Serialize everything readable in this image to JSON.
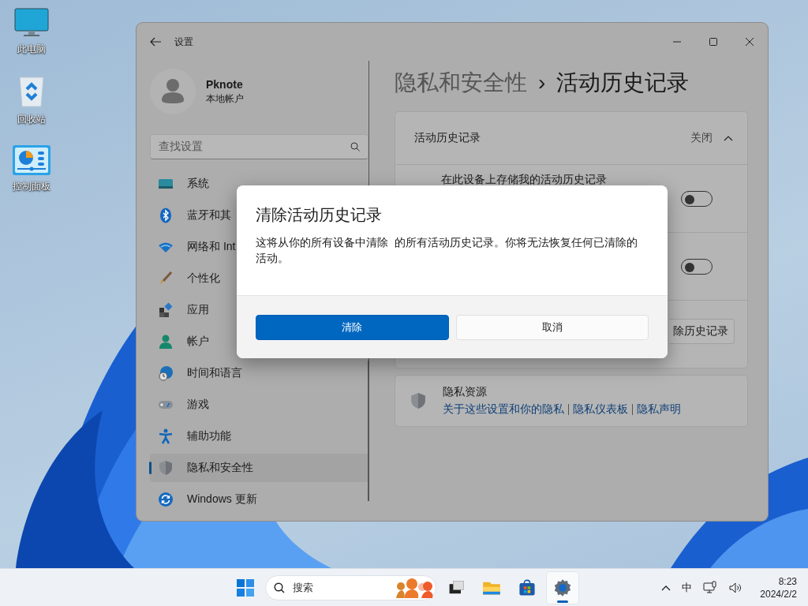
{
  "desktop_icons": [
    {
      "label": "此电脑",
      "kind": "computer"
    },
    {
      "label": "回收站",
      "kind": "recycle"
    },
    {
      "label": "控制面板",
      "kind": "control"
    }
  ],
  "settings_window": {
    "title": "设置",
    "account": {
      "name": "Pknote",
      "type": "本地帐户"
    },
    "search": {
      "placeholder": "查找设置"
    },
    "nav_items": [
      {
        "label": "系统",
        "kind": "system",
        "selected": false
      },
      {
        "label": "蓝牙和其",
        "kind": "bluetooth",
        "selected": false
      },
      {
        "label": "网络和 Int",
        "kind": "wifi",
        "selected": false
      },
      {
        "label": "个性化",
        "kind": "brush",
        "selected": false
      },
      {
        "label": "应用",
        "kind": "apps",
        "selected": false
      },
      {
        "label": "帐户",
        "kind": "person",
        "selected": false
      },
      {
        "label": "时间和语言",
        "kind": "globe",
        "selected": false
      },
      {
        "label": "游戏",
        "kind": "gamepad",
        "selected": false
      },
      {
        "label": "辅助功能",
        "kind": "accessibility",
        "selected": false
      },
      {
        "label": "隐私和安全性",
        "kind": "shield",
        "selected": true
      },
      {
        "label": "Windows 更新",
        "kind": "update",
        "selected": false
      }
    ],
    "breadcrumb": {
      "parent": "隐私和安全性",
      "separator": "›",
      "current": "活动历史记录"
    },
    "activity_card": {
      "title": "活动历史记录",
      "status": "关闭",
      "expanded": true,
      "rows": [
        {
          "kind": "toggle",
          "label": "在此设备上存储我的活动历史记录",
          "on": false
        },
        {
          "kind": "toggle",
          "on": false
        },
        {
          "kind": "button",
          "button": "除历史记录"
        }
      ]
    },
    "privacy_resources": {
      "title": "隐私资源",
      "links": [
        "关于这些设置和你的隐私",
        "隐私仪表板",
        "隐私声明"
      ]
    }
  },
  "dialog": {
    "title": "清除活动历史记录",
    "message": "这将从你的所有设备中清除  的所有活动历史记录。你将无法恢复任何已清除的活动。",
    "buttons": [
      {
        "label": "清除",
        "primary": true
      },
      {
        "label": "取消",
        "primary": false
      }
    ]
  },
  "taskbar": {
    "search": {
      "placeholder": "搜索"
    },
    "apps": [
      {
        "kind": "taskview",
        "active": false
      },
      {
        "kind": "explorer",
        "active": false
      },
      {
        "kind": "store",
        "active": false
      },
      {
        "kind": "settings",
        "active": true
      }
    ],
    "tray": {
      "input_method": "中",
      "time": "8:23",
      "date": "2024/2/2"
    }
  }
}
